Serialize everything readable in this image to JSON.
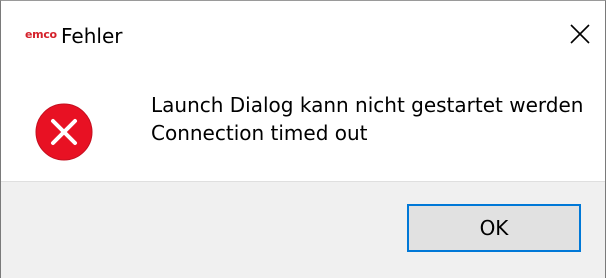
{
  "window": {
    "app_logo_text": "emco",
    "title": "Fehler",
    "close_icon": "close-icon"
  },
  "message": {
    "icon": "error-icon",
    "lines": [
      "Launch Dialog kann nicht gestartet werden",
      "Connection timed out"
    ]
  },
  "buttons": {
    "ok_label": "OK"
  },
  "colors": {
    "error_red": "#e81123",
    "focus_blue": "#0078d7",
    "logo_red": "#d4202a",
    "footer_bg": "#f0f0f0"
  }
}
